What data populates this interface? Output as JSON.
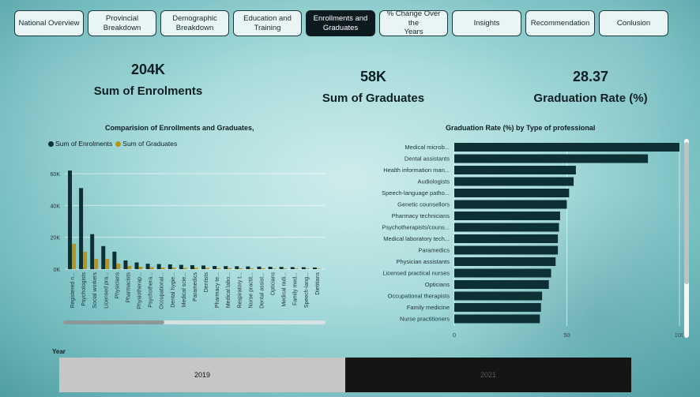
{
  "tabs": [
    {
      "label": "National Overview",
      "active": false
    },
    {
      "label": "Provincial\nBreakdown",
      "active": false
    },
    {
      "label": "Demographic\nBreakdown",
      "active": false
    },
    {
      "label": "Education and\nTraining",
      "active": false
    },
    {
      "label": "Enrollments and\nGraduates",
      "active": true
    },
    {
      "label": "% Change Over the\nYears",
      "active": false
    },
    {
      "label": "Insights",
      "active": false
    },
    {
      "label": "Recommendation",
      "active": false
    },
    {
      "label": "Conlusion",
      "active": false
    }
  ],
  "kpis": {
    "enrolments": {
      "value": "204K",
      "label": "Sum of Enrolments"
    },
    "graduates": {
      "value": "58K",
      "label": "Sum of Graduates"
    },
    "rate": {
      "value": "28.37",
      "label": "Graduation Rate (%)"
    }
  },
  "colors": {
    "enrolments": "#0d3035",
    "graduates": "#b5951f",
    "rate_bar": "#0d3035"
  },
  "chart_data": [
    {
      "type": "bar",
      "title": "Comparision of Enrollments and Graduates,",
      "categories": [
        "Registered n...",
        "Psychologists",
        "Social workers",
        "Licensed pra...",
        "Physicians",
        "Pharmacists",
        "Physiotherap...",
        "Psychothera...",
        "Occupational...",
        "Dental hygie...",
        "Medical scie...",
        "Paramedics",
        "Dentists",
        "Pharmacy te...",
        "Medical labo...",
        "Respiratory t...",
        "Nurse practit...",
        "Dental assist...",
        "Opticians",
        "Medical radi...",
        "Family med...",
        "Speech-lang...",
        "Dietitians"
      ],
      "series": [
        {
          "name": "Sum of Enrolments",
          "values": [
            62000,
            51000,
            22000,
            14500,
            11000,
            5500,
            4200,
            3400,
            3200,
            3000,
            2700,
            2500,
            2300,
            2000,
            1900,
            1800,
            1700,
            1600,
            1500,
            1400,
            1300,
            1200,
            1000
          ]
        },
        {
          "name": "Sum of Graduates",
          "values": [
            16000,
            11000,
            6500,
            6500,
            3500,
            2000,
            1500,
            1200,
            1000,
            900,
            800,
            800,
            700,
            600,
            600,
            500,
            500,
            500,
            400,
            400,
            400,
            350,
            300
          ]
        }
      ],
      "yticks": [
        "0K",
        "20K",
        "40K",
        "60K"
      ],
      "ylim": [
        0,
        70000
      ],
      "xlabel": "",
      "ylabel": "",
      "legend": "top-left",
      "grid": true
    },
    {
      "type": "bar",
      "orientation": "horizontal",
      "title": "Graduation Rate (%) by Type of professional",
      "categories": [
        "Medical microb...",
        "Dental assistants",
        "Health information man...",
        "Audiologists",
        "Speech-language patho...",
        "Genetic counsellors",
        "Pharmacy technicians",
        "Psychotherapists/couns...",
        "Medical laboratory tech...",
        "Paramedics",
        "Physician assistants",
        "Licensed practical nurses",
        "Opticians",
        "Occupational therapists",
        "Family medicine",
        "Nurse practitioners"
      ],
      "values": [
        100,
        86,
        54,
        53,
        51,
        50,
        47,
        46.5,
        46,
        46,
        45,
        43,
        42,
        39,
        38.5,
        38
      ],
      "xticks": [
        "0",
        "50",
        "100"
      ],
      "xlim": [
        0,
        100
      ],
      "grid": true
    }
  ],
  "slicer": {
    "label": "Year",
    "options": [
      {
        "label": "2019",
        "selected": true
      },
      {
        "label": "2021",
        "selected": false
      }
    ]
  }
}
